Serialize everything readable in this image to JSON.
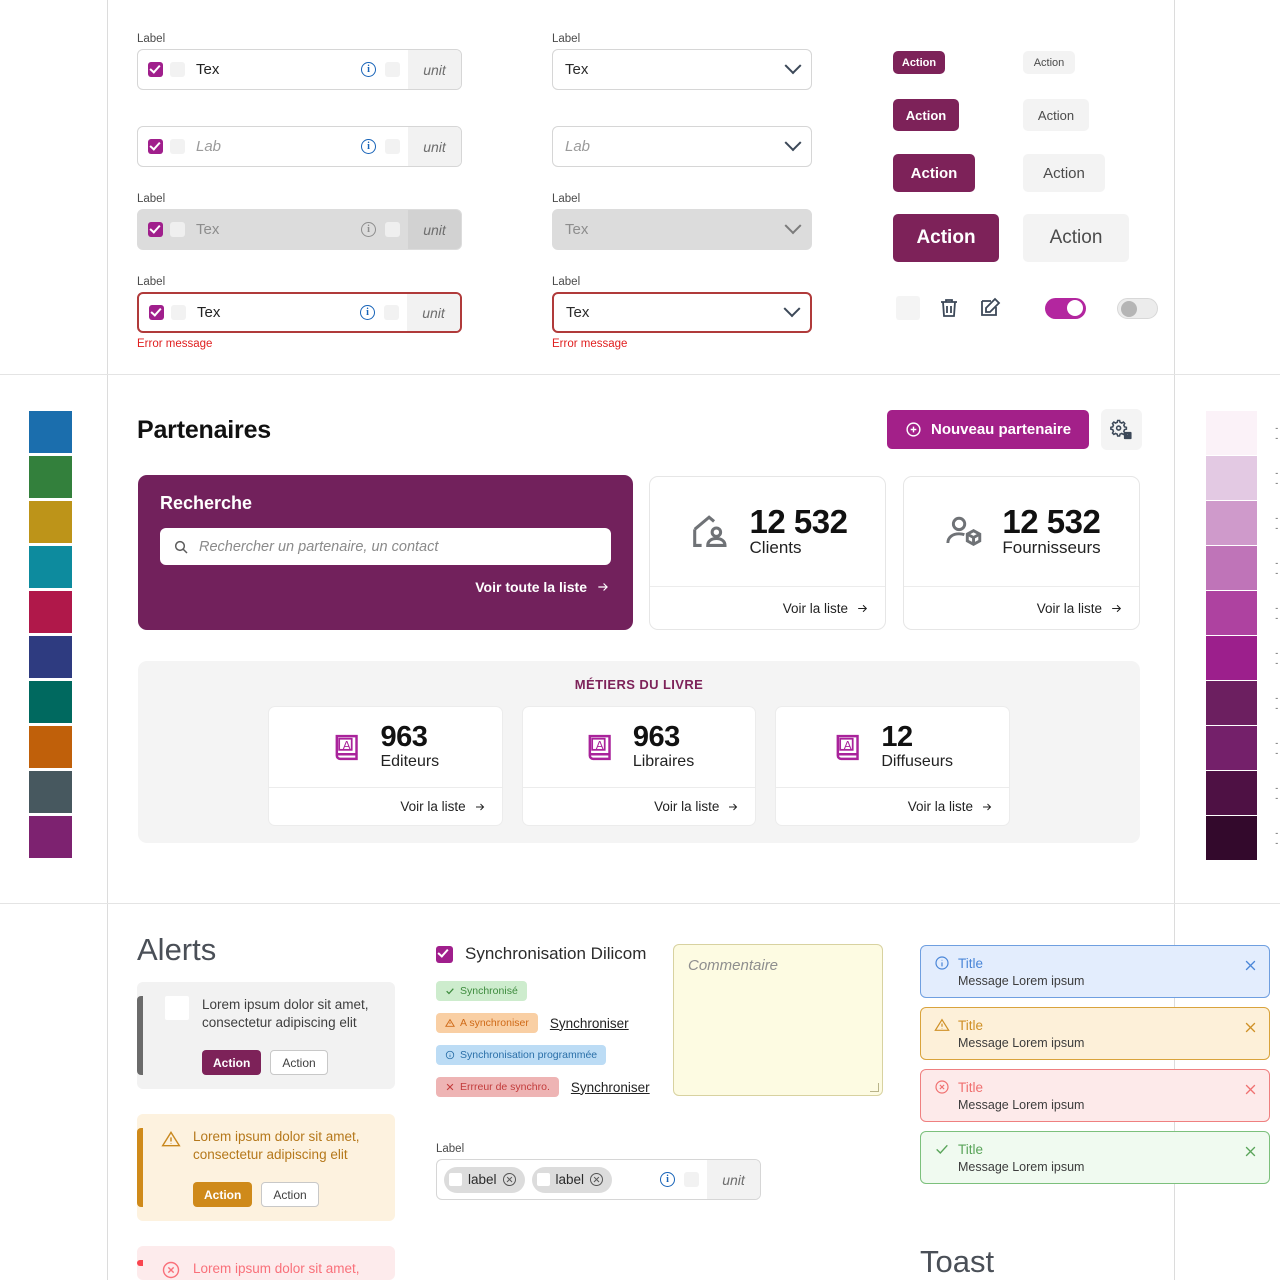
{
  "gridlines": {
    "v1": 107,
    "v2": 1174,
    "h1": 374,
    "h2": 903
  },
  "form_section": {
    "label": "Label",
    "error_message": "Error message",
    "unit": "unit",
    "info_icon": "info-icon",
    "text_fields": [
      {
        "label": "Label",
        "value": "Tex",
        "state": "default",
        "placeholder": false
      },
      {
        "label": "",
        "value": "Lab",
        "state": "default",
        "placeholder": true
      },
      {
        "label": "Label",
        "value": "Tex",
        "state": "disabled",
        "placeholder": false
      },
      {
        "label": "Label",
        "value": "Tex",
        "state": "error",
        "placeholder": false
      }
    ],
    "selects": [
      {
        "label": "Label",
        "value": "Tex",
        "state": "default",
        "placeholder": false
      },
      {
        "label": "",
        "value": "Lab",
        "state": "default",
        "placeholder": true
      },
      {
        "label": "Label",
        "value": "Tex",
        "state": "disabled",
        "placeholder": false
      },
      {
        "label": "Label",
        "value": "Tex",
        "state": "error",
        "placeholder": false
      }
    ],
    "buttons": {
      "primary_label": "Action",
      "secondary_label": "Action",
      "sizes": [
        "s1",
        "s2",
        "s3",
        "s4"
      ]
    },
    "icons": {
      "blank": "blank-checkbox-icon",
      "delete": "trash-icon",
      "edit": "edit-icon",
      "toggle_on": "toggle-on",
      "toggle_off": "toggle-off"
    }
  },
  "partners": {
    "title": "Partenaires",
    "new_partner_button": "Nouveau partenaire",
    "new_partner_icon": "plus-circle-icon",
    "settings_icon": "gear-contact-icon",
    "search": {
      "title": "Recherche",
      "placeholder": "Rechercher un partenaire, un contact",
      "search_icon": "search-icon",
      "see_all": "Voir toute la liste",
      "arrow_icon": "arrow-right-icon"
    },
    "stats": [
      {
        "value": "12 532",
        "label": "Clients",
        "link": "Voir la liste",
        "icon": "home-person-icon"
      },
      {
        "value": "12 532",
        "label": "Fournisseurs",
        "link": "Voir la liste",
        "icon": "person-box-icon"
      }
    ],
    "metiers": {
      "title": "MÉTIERS DU LIVRE",
      "cards": [
        {
          "value": "963",
          "label": "Editeurs",
          "link": "Voir la liste",
          "icon": "book-a-icon"
        },
        {
          "value": "963",
          "label": "Libraires",
          "link": "Voir la liste",
          "icon": "book-a-icon"
        },
        {
          "value": "12",
          "label": "Diffuseurs",
          "link": "Voir la liste",
          "icon": "book-a-icon"
        }
      ]
    }
  },
  "alerts": {
    "title": "Alerts",
    "items": [
      {
        "kind": "neutral",
        "icon": "checkbox-icon",
        "text": "Lorem ipsum dolor sit amet, consectetur adipiscing elit",
        "primary": "Action",
        "secondary": "Action",
        "bar": "#6b6b6b",
        "bg": "#f2f2f2",
        "fg": "#3f3f3f",
        "btn": "#7d2259"
      },
      {
        "kind": "warning",
        "icon": "warning-triangle-icon",
        "text": "Lorem ipsum dolor sit amet, consectetur adipiscing elit",
        "primary": "Action",
        "secondary": "Action",
        "bar": "#cf8a1a",
        "bg": "#fdf2df",
        "fg": "#b5781b",
        "btn": "#cf8a1a"
      },
      {
        "kind": "error",
        "icon": "error-circle-icon",
        "text": "Lorem ipsum dolor sit amet,",
        "primary": "",
        "secondary": "",
        "bar": "#f9454f",
        "bg": "#fdebec",
        "fg": "#f9707a",
        "btn": "#f9454f"
      }
    ]
  },
  "sync": {
    "title": "Synchronisation Dilicom",
    "checkbox_checked": true,
    "badges": [
      {
        "label": "Synchronisé",
        "icon": "check-icon",
        "bg": "#cdeccd",
        "fg": "#3d8b3d",
        "action": ""
      },
      {
        "label": "A synchroniser",
        "icon": "warning-triangle-icon",
        "bg": "#f9cfa4",
        "fg": "#cf6a18",
        "action": "Synchroniser"
      },
      {
        "label": "Synchronisation programmée",
        "icon": "info-circle-icon",
        "bg": "#bcdcf5",
        "fg": "#2a6fa8",
        "action": ""
      },
      {
        "label": "Errreur de synchro.",
        "icon": "x-icon",
        "bg": "#eeb4b4",
        "fg": "#c23b3b",
        "action": "Synchroniser"
      }
    ],
    "comment_placeholder": "Commentaire",
    "tag_field": {
      "label": "Label",
      "tags": [
        "label",
        "label"
      ],
      "unit": "unit",
      "remove_icon": "remove-circle-icon",
      "info_icon": "info-icon"
    }
  },
  "toast": {
    "heading": "Toast",
    "items": [
      {
        "title": "Title",
        "message": "Message Lorem ipsum",
        "icon": "info-circle-icon",
        "bg": "#e3edfd",
        "border": "#6f9fe0",
        "fg": "#4a86d8",
        "close": "close-icon"
      },
      {
        "title": "Title",
        "message": "Message Lorem ipsum",
        "icon": "warning-triangle-icon",
        "bg": "#fdf0d9",
        "border": "#d9a33c",
        "fg": "#cf9026",
        "close": "close-icon"
      },
      {
        "title": "Title",
        "message": "Message Lorem ipsum",
        "icon": "error-circle-icon",
        "bg": "#fdeaea",
        "border": "#ef8080",
        "fg": "#f07070",
        "close": "close-icon"
      },
      {
        "title": "Title",
        "message": "Message Lorem ipsum",
        "icon": "check-icon",
        "bg": "#f0faf0",
        "border": "#7cc07c",
        "fg": "#59a459",
        "close": "close-icon"
      }
    ]
  },
  "palette_left": {
    "name": "categorical-swatches",
    "colors": [
      "#1b6ead",
      "#33803c",
      "#bd9419",
      "#0d8b9e",
      "#b0184a",
      "#2e3b80",
      "#00695f",
      "#c0600a",
      "#47585f",
      "#7d2270"
    ]
  },
  "palette_right": {
    "name": "purple-scale-swatches",
    "colors": [
      "#fbf2f8",
      "#e3c9e3",
      "#cf9acb",
      "#bf74b8",
      "#ae42a0",
      "#9c1f8c",
      "#6c1f60",
      "#74206a",
      "#4e1144",
      "#33092c"
    ],
    "label_text": "--"
  }
}
